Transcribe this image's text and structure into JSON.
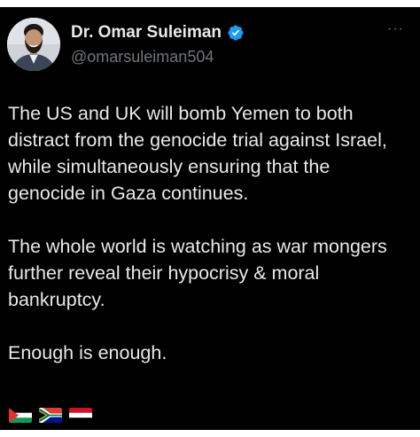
{
  "author": {
    "display_name": "Dr. Omar Suleiman",
    "handle": "@omarsuleiman504",
    "verified": true,
    "verified_color": "#1d9bf0"
  },
  "more_menu_label": "···",
  "tweet": {
    "paragraphs": [
      "The US and UK will bomb Yemen to both distract from the genocide trial against Israel, while simultaneously ensuring that the genocide in Gaza continues.",
      "The whole world is watching as war mongers further reveal their hypocrisy & moral bankruptcy.",
      "Enough is enough."
    ],
    "flag_emojis": [
      "palestine-flag",
      "south-africa-flag",
      "yemen-flag"
    ]
  },
  "colors": {
    "background": "#000000",
    "text": "#e7e9ea",
    "secondary_text": "#71767b"
  }
}
